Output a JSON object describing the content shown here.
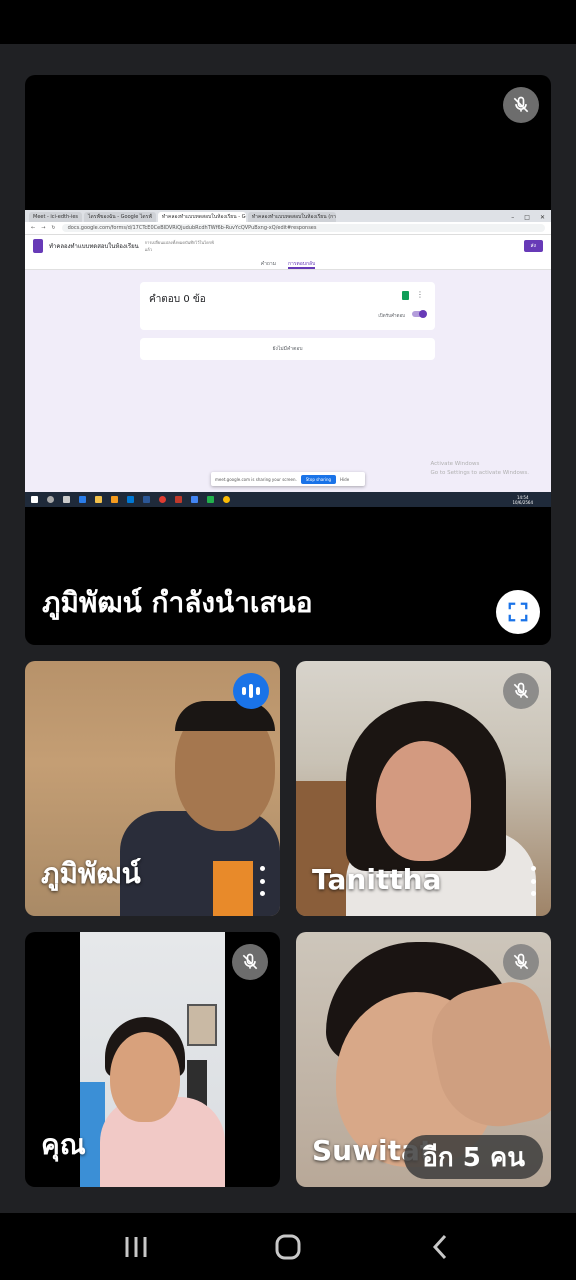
{
  "presenter_banner": "ภูมิพัฒน์ กำลังนำเสนอ",
  "shared_screen": {
    "browser_tabs": [
      "Meet - ici-edth-ies",
      "ไดรฟ์ของฉัน - Google ไดรฟ์",
      "ทำคลองทำแบบทดสอบในห้องเรียน - Go",
      "ทำคลองทำแบบทดสอบในห้องเรียน (การ"
    ],
    "url": "docs.google.com/forms/d/17CTcE0CeBIDVRiQjudubRcdhTWf6b-RuvYcQVPuBxng-xQ/edit#responses",
    "form_title": "ทำคลองทำแบบทดสอบในห้องเรียน",
    "autosave_note": "การเปลี่ยนแปลงทั้งหมดบันทึกไว้ในไดรฟ์แล้ว",
    "send_label": "ส่ง",
    "tabs": [
      "คำถาม",
      "การตอบกลับ"
    ],
    "responses_title": "คำตอบ 0 ข้อ",
    "accepting_label": "เปิดรับคำตอบ",
    "empty_note": "ยังไม่มีคำตอบ",
    "share_bar_text": "meet.google.com is sharing your screen.",
    "stop_sharing": "Stop sharing",
    "hide": "Hide",
    "activate_title": "Activate Windows",
    "activate_sub": "Go to Settings to activate Windows.",
    "clock_time": "14:54",
    "clock_date": "10/6/2564",
    "lang": "ENG"
  },
  "participants": [
    {
      "name": "ภูมิพัฒน์",
      "status": "speaking"
    },
    {
      "name": "Tanittha",
      "status": "muted"
    },
    {
      "name": "คุณ",
      "status": "muted"
    },
    {
      "name": "Suwitat",
      "status": "muted"
    }
  ],
  "more_people": "อีก 5 คน",
  "colors": {
    "accent": "#1a73e8",
    "forms": "#673ab7",
    "background": "#202124"
  },
  "icons": [
    "mic-off-icon",
    "fullscreen-icon",
    "speaking-icon",
    "more-vert-icon",
    "recents-icon",
    "home-icon",
    "back-icon"
  ]
}
